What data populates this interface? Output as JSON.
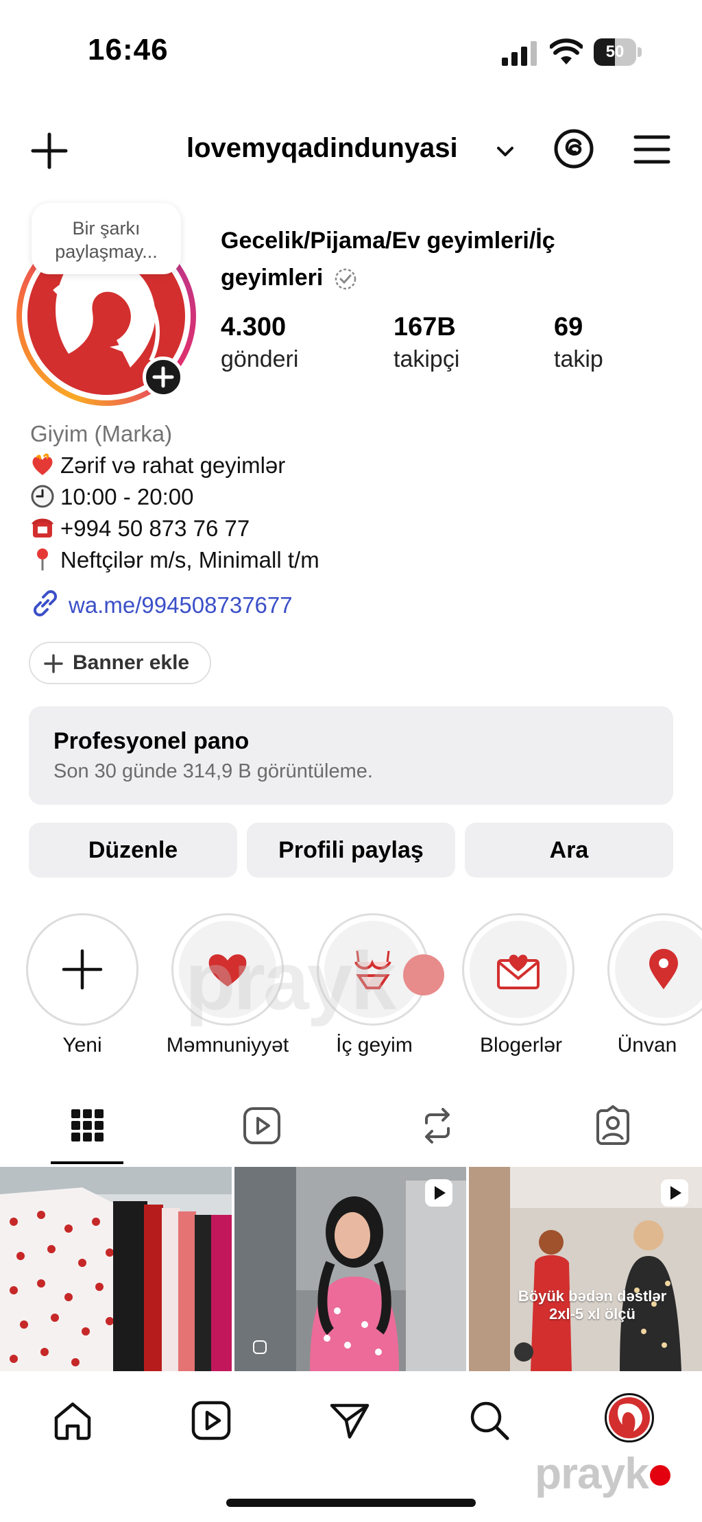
{
  "status_bar": {
    "time": "16:46",
    "battery": "50",
    "battery_level": 0.5
  },
  "header": {
    "username": "lovemyqadindunyasi"
  },
  "profile": {
    "note": "Bir şarkı paylaşmay...",
    "full_name": "Gecelik/Pijama/Ev geyimleri/İç geyimleri",
    "stats": [
      {
        "value": "4.300",
        "label": "gönderi"
      },
      {
        "value": "167B",
        "label": "takipçi"
      },
      {
        "value": "69",
        "label": "takip"
      }
    ],
    "category": "Giyim (Marka)",
    "bio": [
      {
        "icon": "heart-fire-emoji",
        "text": "Zərif və rahat geyimlər"
      },
      {
        "icon": "clock-emoji",
        "text": "10:00 - 20:00"
      },
      {
        "icon": "telephone-emoji",
        "text": "+994 50 873 76 77"
      },
      {
        "icon": "pushpin-emoji",
        "text": "Neftçilər m/s, Minimall t/m"
      }
    ],
    "link": "wa.me/994508737677"
  },
  "banner_button": "Banner ekle",
  "dashboard": {
    "title": "Profesyonel pano",
    "subtitle": "Son 30 günde 314,9 B görüntüleme."
  },
  "actions": {
    "edit": "Düzenle",
    "share": "Profili paylaş",
    "search": "Ara"
  },
  "highlights": [
    {
      "label": "Yeni",
      "icon": "plus-icon"
    },
    {
      "label": "Məmnuniyyət",
      "icon": "heart-icon"
    },
    {
      "label": "İç geyim",
      "icon": "lingerie-icon"
    },
    {
      "label": "Blogerlər",
      "icon": "envelope-heart-icon"
    },
    {
      "label": "Ünvan",
      "icon": "location-pin-icon"
    }
  ],
  "grid": {
    "tile3_caption_1": "Böyük bədən dəstlər",
    "tile3_caption_2": "2xl-5 xl ölçü"
  },
  "watermark": "prayk",
  "colors": {
    "accent_red": "#d32f2f",
    "link_blue": "#3b4fc8",
    "button_bg": "#efeff1"
  }
}
